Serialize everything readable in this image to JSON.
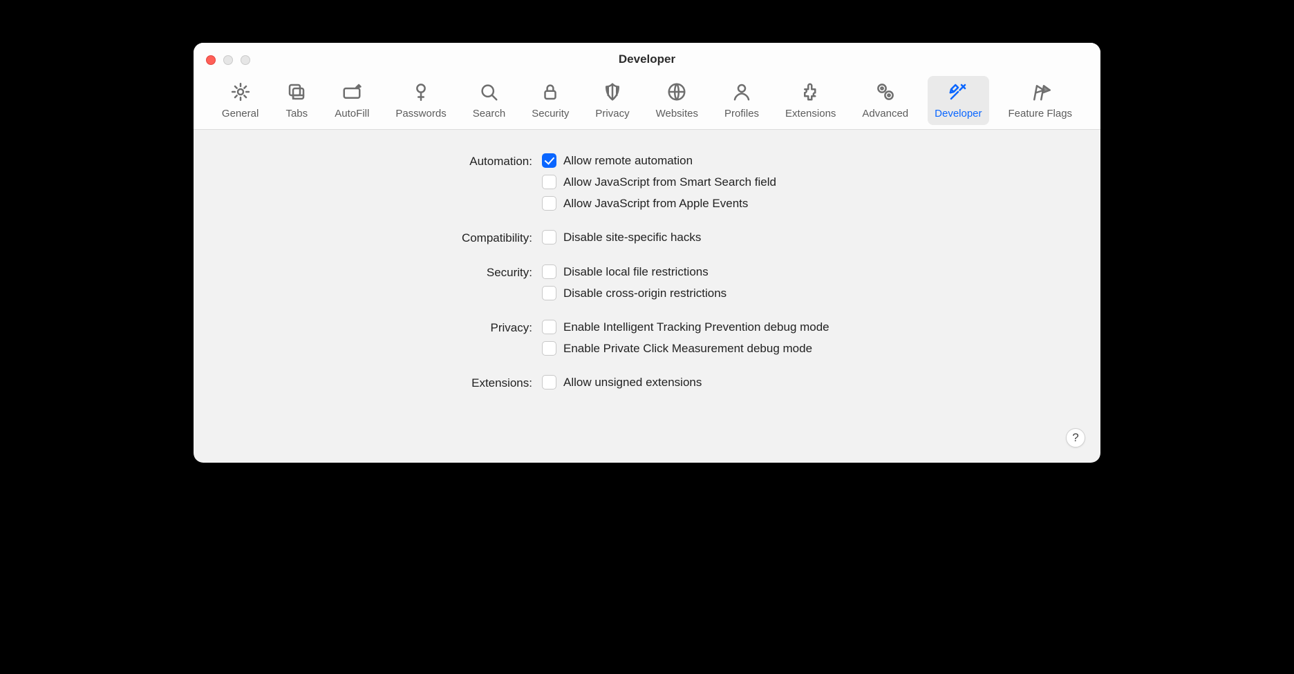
{
  "window": {
    "title": "Developer"
  },
  "tabs": [
    {
      "id": "general",
      "label": "General"
    },
    {
      "id": "tabs",
      "label": "Tabs"
    },
    {
      "id": "autofill",
      "label": "AutoFill"
    },
    {
      "id": "passwords",
      "label": "Passwords"
    },
    {
      "id": "search",
      "label": "Search"
    },
    {
      "id": "security",
      "label": "Security"
    },
    {
      "id": "privacy",
      "label": "Privacy"
    },
    {
      "id": "websites",
      "label": "Websites"
    },
    {
      "id": "profiles",
      "label": "Profiles"
    },
    {
      "id": "extensions",
      "label": "Extensions"
    },
    {
      "id": "advanced",
      "label": "Advanced"
    },
    {
      "id": "developer",
      "label": "Developer"
    },
    {
      "id": "featureflags",
      "label": "Feature Flags"
    }
  ],
  "active_tab_id": "developer",
  "sections": {
    "automation": {
      "label": "Automation:",
      "items": [
        {
          "id": "allow-remote-automation",
          "label": "Allow remote automation",
          "checked": true
        },
        {
          "id": "allow-js-smart-search",
          "label": "Allow JavaScript from Smart Search field",
          "checked": false
        },
        {
          "id": "allow-js-apple-events",
          "label": "Allow JavaScript from Apple Events",
          "checked": false
        }
      ]
    },
    "compatibility": {
      "label": "Compatibility:",
      "items": [
        {
          "id": "disable-site-hacks",
          "label": "Disable site-specific hacks",
          "checked": false
        }
      ]
    },
    "security": {
      "label": "Security:",
      "items": [
        {
          "id": "disable-local-file",
          "label": "Disable local file restrictions",
          "checked": false
        },
        {
          "id": "disable-cross-origin",
          "label": "Disable cross-origin restrictions",
          "checked": false
        }
      ]
    },
    "privacy": {
      "label": "Privacy:",
      "items": [
        {
          "id": "itp-debug",
          "label": "Enable Intelligent Tracking Prevention debug mode",
          "checked": false
        },
        {
          "id": "pcm-debug",
          "label": "Enable Private Click Measurement debug mode",
          "checked": false
        }
      ]
    },
    "extensions": {
      "label": "Extensions:",
      "items": [
        {
          "id": "allow-unsigned-ext",
          "label": "Allow unsigned extensions",
          "checked": false
        }
      ]
    }
  },
  "help_glyph": "?"
}
